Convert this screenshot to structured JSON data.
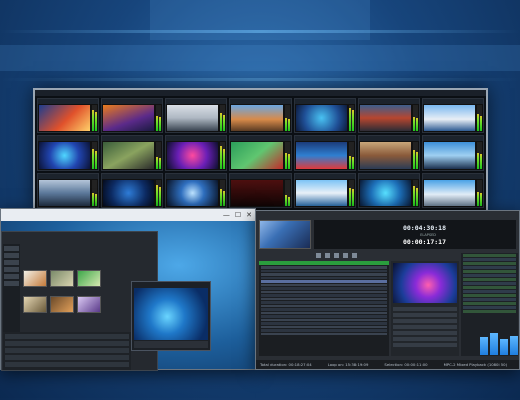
{
  "colors": {
    "background": "#17457c",
    "accent": "#2a9d3d",
    "meter_green": "#1ec71e"
  },
  "multiviewer": {
    "tiles": [
      {
        "img": "linear-gradient(135deg,#1c3d8f,#e0512b 55%,#ffd16a)",
        "level": 0.8
      },
      {
        "img": "linear-gradient(160deg,#e97c1d,#5b2a8a 60%,#1a1a40)",
        "level": 0.6
      },
      {
        "img": "linear-gradient(180deg,#d9dee6,#aeb7c2 50%,#394350)",
        "level": 0.7
      },
      {
        "img": "linear-gradient(180deg,#6ba6e0,#d88b4a 55%,#5a3b23)",
        "level": 0.5
      },
      {
        "img": "radial-gradient(circle,#49c2f2,#1f4f96 60%,#0d1a3a)",
        "level": 0.9
      },
      {
        "img": "linear-gradient(180deg,#3d5e8c,#b7462f 50%,#2c2c35)",
        "level": 0.55
      },
      {
        "img": "linear-gradient(180deg,#7ab8f0,#e8eef5 55%,#2e5b92)",
        "level": 0.65
      },
      {
        "img": "radial-gradient(circle,#4fd7ff,#2145b0 50%,#0b1336)",
        "level": 0.75
      },
      {
        "img": "linear-gradient(150deg,#3a5d3a,#8aa35f 50%,#2b2b2b)",
        "level": 0.45
      },
      {
        "img": "radial-gradient(circle,#ff4a9e,#6a1fb6 50%,#0c0f2b)",
        "level": 0.85
      },
      {
        "img": "linear-gradient(140deg,#2b9d5a,#60c670 50%,#c32a2a)",
        "level": 0.6
      },
      {
        "img": "linear-gradient(180deg,#1b3b7a,#2f7fd1 50%,#e03a3a)",
        "level": 0.5
      },
      {
        "img": "linear-gradient(180deg,#c9a77a,#8a5a3a 50%,#2a3b55)",
        "level": 0.7
      },
      {
        "img": "linear-gradient(180deg,#3d8fd8,#9fd0f2 50%,#1b2f4d)",
        "level": 0.6
      },
      {
        "img": "linear-gradient(180deg,#b4c5d9,#5d7a9c 50%,#233246)",
        "level": 0.5
      },
      {
        "img": "radial-gradient(circle,#2f7dd8,#0d2b63 60%,#050b1c)",
        "level": 0.8
      },
      {
        "img": "radial-gradient(circle,#bde3ff,#2f6fbf 40%,#0a1428)",
        "level": 0.65
      },
      {
        "img": "linear-gradient(180deg,#4d0f0f,#120606)",
        "level": 0.4
      },
      {
        "img": "linear-gradient(180deg,#7cc3f5,#e9f1f8 50%,#2c6ca8)",
        "level": 0.7
      },
      {
        "img": "radial-gradient(circle,#58e0ff,#1d6fb8 50%,#0a1a36)",
        "level": 0.75
      },
      {
        "img": "linear-gradient(180deg,#4aa2e6,#e2edf7 55%,#6b7f93)",
        "level": 0.55
      }
    ]
  },
  "left_window": {
    "controls": [
      "—",
      "☐",
      "✕"
    ]
  },
  "playout": {
    "timer_elapsed": "00:04:30:18",
    "timer_label": "ELAPSED",
    "timer_remaining": "00:00:17:17",
    "status": {
      "total_duration": "Total duration: 00:18:27:04",
      "loop": "Loop on: 15:38:19:09",
      "selection": "Selection: 00:00:11:00",
      "device": "MPC-2 Mixed Playback (1080i 50)"
    }
  }
}
